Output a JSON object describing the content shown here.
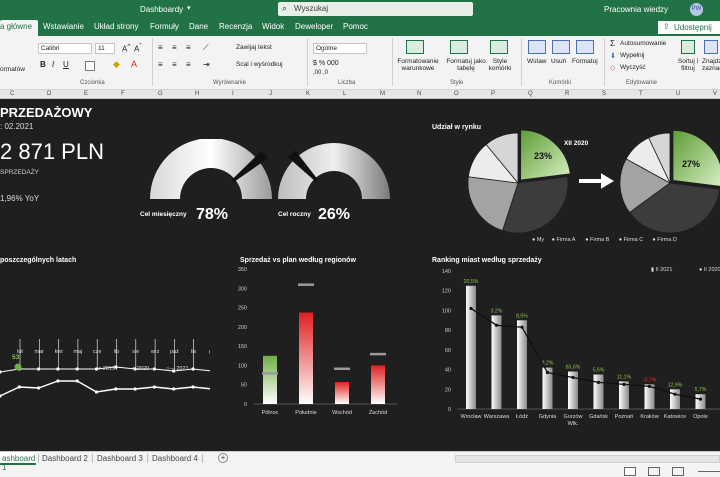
{
  "titlebar": {
    "title": "Dashboardy",
    "search_placeholder": "Wyszukaj",
    "user": "Pracownia wiedzy",
    "avatar": "PW"
  },
  "tabs": [
    "a główne",
    "Wstawianie",
    "Układ strony",
    "Formuły",
    "Dane",
    "Recenzja",
    "Widok",
    "Deweloper",
    "Pomoc"
  ],
  "share_label": "Udostępnij",
  "ribbon": {
    "font_name": "Calibri",
    "font_size": "11",
    "wrap_text": "Zawijaj tekst",
    "merge": "Scal i wyśrodkuj",
    "number_format": "Ogólne",
    "styles_items": [
      "Formatowanie warunkowe",
      "Formatuj jako tabelę",
      "Style komórki"
    ],
    "cells_items": [
      "Wstaw",
      "Usuń",
      "Formatuj"
    ],
    "edit_items": [
      "Autosumowanie",
      "Wypełnij",
      "Wyczyść"
    ],
    "sort_label": "Sortuj i filtruj",
    "find_label": "Znajdź i zaznacz",
    "group_labels": [
      "Czcionka",
      "Wyrównanie",
      "Liczba",
      "Style",
      "Komórki",
      "Edytowanie"
    ],
    "left_label": "ormatów"
  },
  "columns": [
    "C",
    "D",
    "E",
    "F",
    "G",
    "H",
    "I",
    "J",
    "K",
    "L",
    "M",
    "N",
    "O",
    "P",
    "Q",
    "R",
    "S",
    "T",
    "U",
    "V"
  ],
  "dashboard": {
    "title": "PRZEDAŻOWY",
    "date": ": 02.2021",
    "kpi_value": "2 871 PLN",
    "kpi_label": "SPRZEDAŻY",
    "kpi_yoy": "1,96% YoY",
    "gauges": [
      {
        "label": "Cel miesięczny",
        "value": "78%",
        "fraction": 0.78
      },
      {
        "label": "Cel roczny",
        "value": "26%",
        "fraction": 0.26
      }
    ],
    "market_title": "Udział w rynku",
    "market_period": "XII 2020",
    "market_legend": [
      "My",
      "Firma A",
      "Firma B",
      "Firma C",
      "Firma D"
    ],
    "market_pie_labels": [
      "23%",
      "27%"
    ],
    "market_shares_left": [
      23,
      32,
      22,
      12,
      11
    ],
    "market_shares_right": [
      27,
      38,
      18,
      10,
      7
    ],
    "years_title": "poszczególnych latach",
    "years_marker": "53",
    "months": [
      "lut",
      "mar",
      "kwi",
      "maj",
      "cze",
      "lip",
      "sie",
      "wrz",
      "paź",
      "lis",
      "gru"
    ],
    "years_legend": [
      "2019",
      "2020",
      "2021"
    ],
    "regions_title": "Sprzedaż vs plan według regionów",
    "regions_yticks": [
      "350",
      "300",
      "250",
      "200",
      "150",
      "100",
      "50",
      "0"
    ],
    "regions": [
      "Północ",
      "Południe",
      "Wschód",
      "Zachód"
    ],
    "region_sales": [
      125,
      237,
      57,
      100
    ],
    "region_plan": [
      80,
      310,
      92,
      130
    ],
    "ranking_title": "Ranking miast według sprzedaży",
    "ranking_legend": [
      "2021",
      "2020"
    ],
    "ranking_yticks": [
      "140",
      "120",
      "100",
      "80",
      "60",
      "40",
      "20",
      "0"
    ],
    "cities": [
      "Wrocław",
      "Warszawa",
      "Łódź",
      "Gdynia",
      "Gorzów Wlk.",
      "Gdańsk",
      "Poznań",
      "Kraków",
      "Katowice",
      "Opole"
    ],
    "city_sales": [
      125,
      95,
      90,
      42,
      38,
      35,
      28,
      25,
      20,
      15
    ],
    "city_prev": [
      102,
      85,
      83,
      37,
      32,
      27,
      25,
      23,
      15,
      10
    ],
    "city_labels": [
      "20,5%",
      "3,2%",
      "8,5%",
      "8,2%",
      "65,6%",
      "5,6%",
      "11,1%",
      "-0,7%",
      "12,9%",
      "5,7%"
    ],
    "city_label_colors": [
      "#8bc34a",
      "#8bc34a",
      "#8bc34a",
      "#8bc34a",
      "#8bc34a",
      "#8bc34a",
      "#8bc34a",
      "#e53935",
      "#8bc34a",
      "#8bc34a"
    ]
  },
  "sheets": [
    "ashboard 1",
    "Dashboard 2",
    "Dashboard 3",
    "Dashboard 4"
  ],
  "colors": {
    "excel_green": "#217346",
    "accent_green": "#6fae45",
    "accent_red": "#e02020"
  }
}
